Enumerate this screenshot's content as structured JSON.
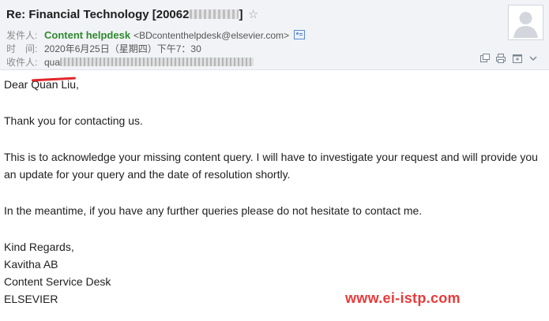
{
  "header": {
    "subject_prefix": "Re: Financial Technology [20062",
    "subject_suffix": "]",
    "star_glyph": "☆",
    "from_label": "发件人:",
    "sender_name": "Content helpdesk",
    "sender_email": "<BDcontenthelpdesk@elsevier.com>",
    "time_label": "时　间:",
    "time_value": "2020年6月25日（星期四）下午7：30",
    "to_label": "收件人:",
    "to_value": "qua"
  },
  "toolbar": {
    "icons": [
      "popout-window-icon",
      "print-icon",
      "new-window-icon",
      "more-icon"
    ]
  },
  "body": {
    "greeting": "Dear Quan Liu,",
    "p1": "Thank you for contacting us.",
    "p2_line1": "This is to acknowledge your missing content query. I will have to investigate your request and will provide you",
    "p2_line2": "an update for your query and the date of resolution shortly.",
    "p3": "In the meantime, if you have any further queries please do not hesitate to contact me.",
    "sign1": "Kind Regards,",
    "sign2": "Kavitha AB",
    "sign3": "Content Service Desk",
    "sign4": "ELSEVIER"
  },
  "watermark": "www.ei-istp.com",
  "colors": {
    "sender_green": "#2f8a2f",
    "header_bg": "#f1f3f6",
    "watermark_red": "#e83a3a"
  }
}
